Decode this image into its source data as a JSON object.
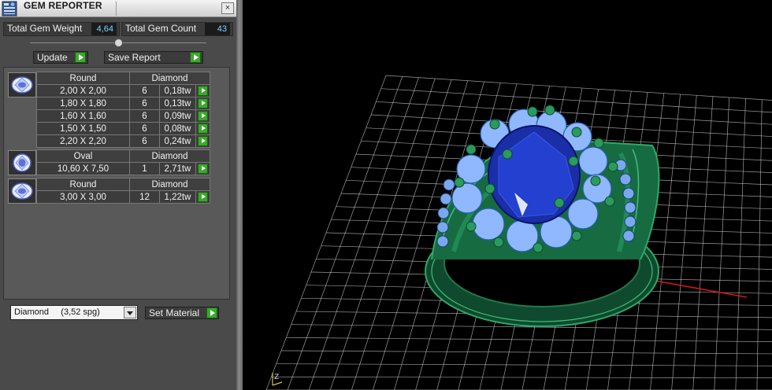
{
  "window": {
    "title": "GEM REPORTER",
    "close_glyph": "×",
    "icon": "gem-reporter-app-icon"
  },
  "stats": {
    "weight_label": "Total Gem Weight",
    "weight_value": "4,64",
    "count_label": "Total Gem Count",
    "count_value": "43"
  },
  "buttons": {
    "update": "Update",
    "save_report": "Save Report",
    "set_material": "Set Material"
  },
  "gem_groups": [
    {
      "shape": "Round",
      "material": "Diamond",
      "thumb_icon": "round-gem-icon",
      "rows": [
        {
          "size": "2,00 X 2,00",
          "count": "6",
          "weight": "0,18tw"
        },
        {
          "size": "1,80 X 1,80",
          "count": "6",
          "weight": "0,13tw"
        },
        {
          "size": "1,60 X 1,60",
          "count": "6",
          "weight": "0,09tw"
        },
        {
          "size": "1,50 X 1,50",
          "count": "6",
          "weight": "0,08tw"
        },
        {
          "size": "2,20 X 2,20",
          "count": "6",
          "weight": "0,24tw"
        }
      ]
    },
    {
      "shape": "Oval",
      "material": "Diamond",
      "thumb_icon": "oval-gem-icon",
      "rows": [
        {
          "size": "10,60 X 7,50",
          "count": "1",
          "weight": "2,71tw"
        }
      ]
    },
    {
      "shape": "Round",
      "material": "Diamond",
      "thumb_icon": "round-gem-icon",
      "rows": [
        {
          "size": "3,00 X 3,00",
          "count": "12",
          "weight": "1,22tw"
        }
      ]
    }
  ],
  "material": {
    "selected": "Diamond     (3,52 spg)"
  },
  "viewport": {
    "axis_label": "Z",
    "metal_color": "#1f7a4e",
    "center_stone_color": "#1a2ea8",
    "side_stone_color": "#8fb8ff",
    "grid_color": "#cfcfcf",
    "axis_color": "#d01818"
  },
  "colors": {
    "accent_play": "#3aa92a",
    "value_text": "#7fd3ff"
  }
}
